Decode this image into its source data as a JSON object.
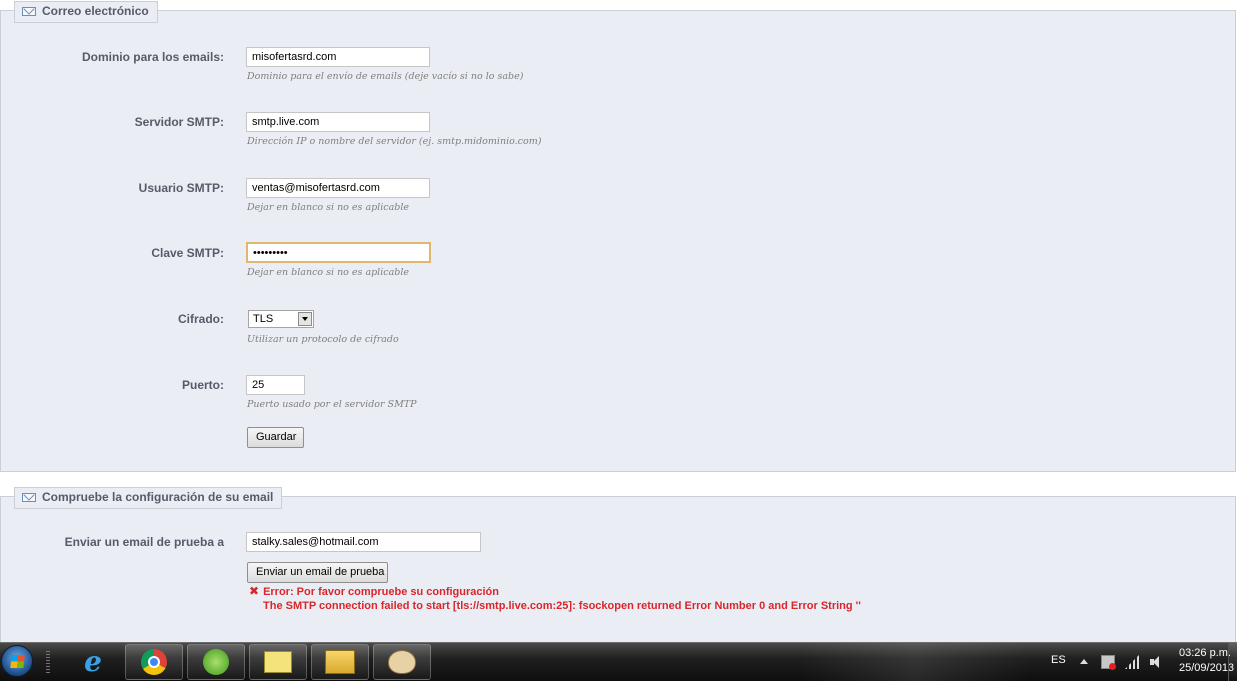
{
  "email_section": {
    "legend": "Correo electrónico",
    "fields": [
      {
        "label": "Dominio para los emails:",
        "value": "misofertasrd.com",
        "hint": "Dominio para el envío de emails (deje vacío si no lo sabe)"
      },
      {
        "label": "Servidor SMTP:",
        "value": "smtp.live.com",
        "hint": "Dirección IP o nombre del servidor (ej. smtp.midominio.com)"
      },
      {
        "label": "Usuario SMTP:",
        "value": "ventas@misofertasrd.com",
        "hint": "Dejar en blanco si no es aplicable"
      },
      {
        "label": "Clave SMTP:",
        "value": "•••••••••",
        "hint": "Dejar en blanco si no es aplicable"
      },
      {
        "label": "Cifrado:",
        "value": "TLS",
        "hint": "Utilizar un protocolo de cifrado"
      },
      {
        "label": "Puerto:",
        "value": "25",
        "hint": "Puerto usado por el servidor SMTP"
      }
    ],
    "save_label": "Guardar"
  },
  "test_section": {
    "legend": "Compruebe la configuración de su email",
    "label": "Enviar un email de prueba a",
    "value": "stalky.sales@hotmail.com",
    "button_label": "Enviar un email de prueba",
    "error_line1": "Error: Por favor compruebe su configuración",
    "error_line2": "The SMTP connection failed to start [tls://smtp.live.com:25]: fsockopen returned Error Number 0 and Error String ''"
  },
  "taskbar": {
    "apps": [
      "internet-explorer-icon",
      "chrome-icon",
      "green-app-icon",
      "sticky-notes-icon",
      "file-explorer-icon",
      "paint-icon"
    ],
    "language": "ES",
    "time": "03:26 p.m.",
    "date": "25/09/2013"
  },
  "colors": {
    "panel_bg": "#ebedf4",
    "panel_border": "#ccced7",
    "error": "#d9262b",
    "focus_border": "#e3b66f"
  }
}
